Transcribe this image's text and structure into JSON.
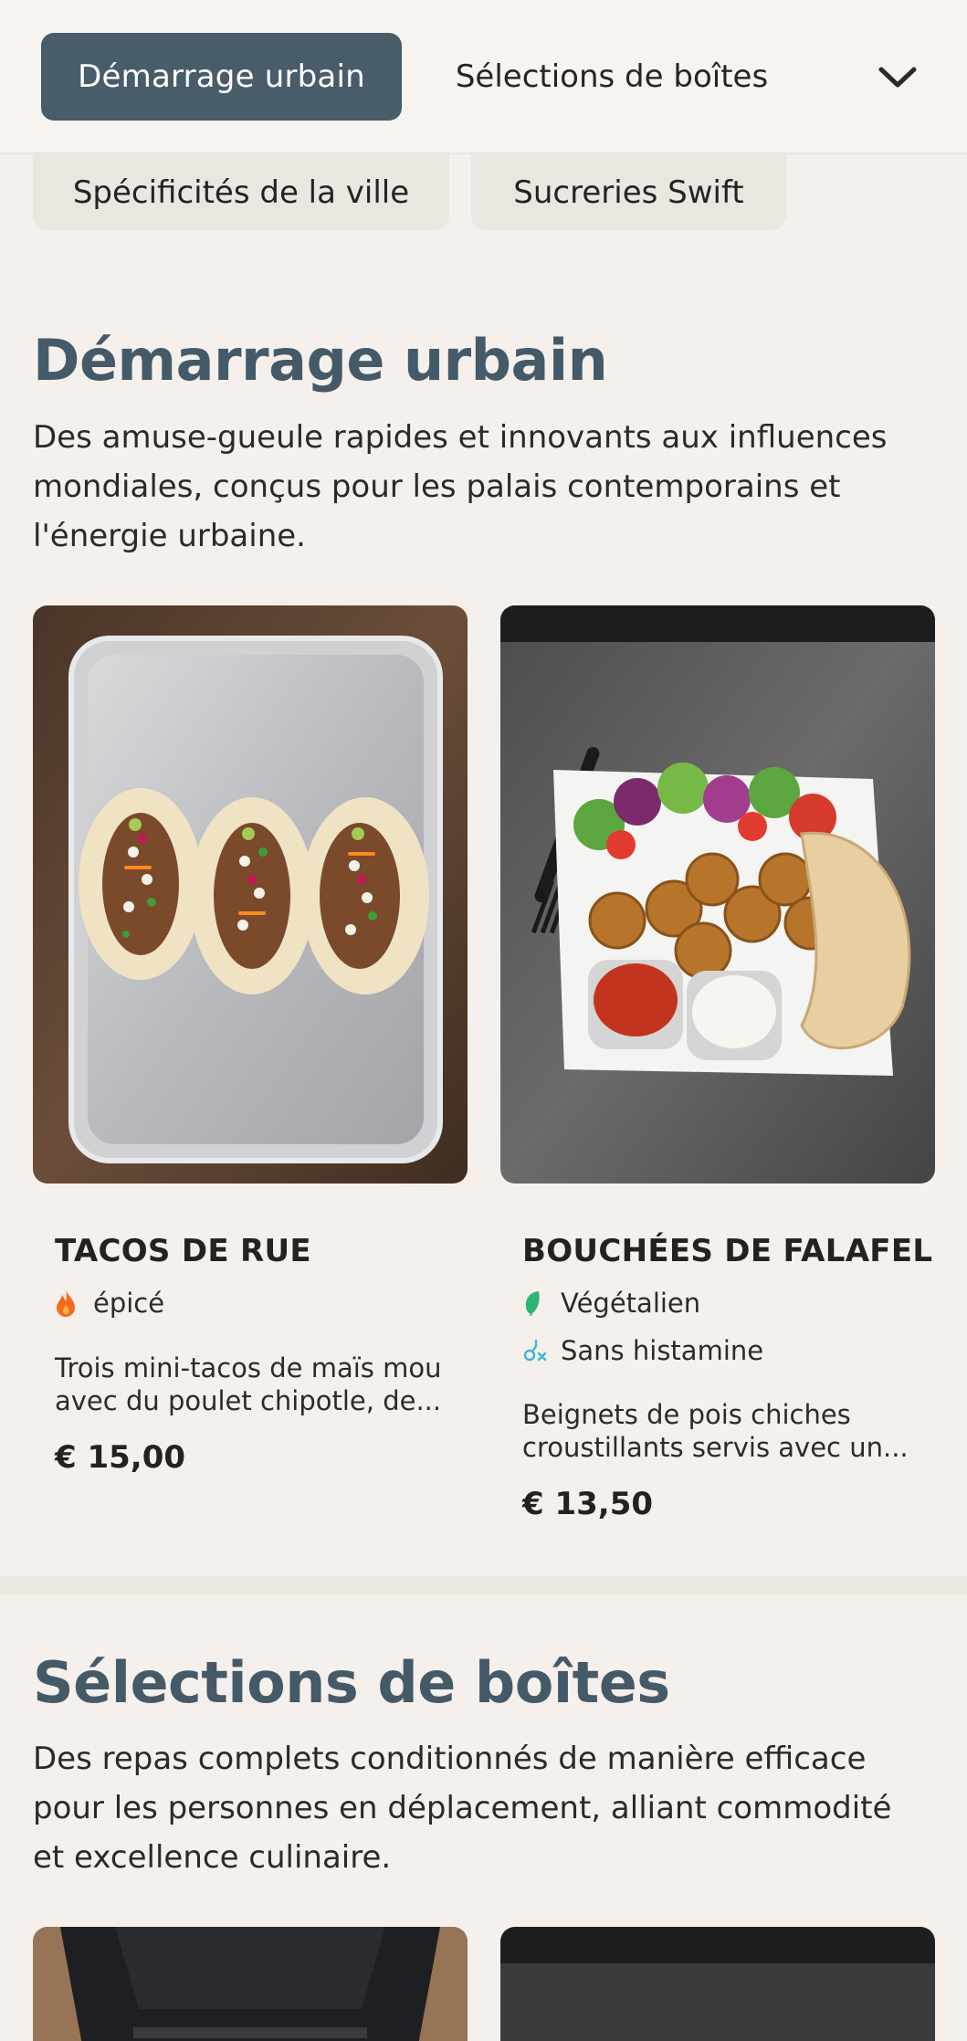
{
  "nav": {
    "active_tab": "Démarrage urbain",
    "next_tab": "Sélections de boîtes",
    "more_icon": "chevron-down-icon"
  },
  "chips": [
    "Spécificités de la ville",
    "Sucreries Swift"
  ],
  "sections": [
    {
      "title": "Démarrage urbain",
      "description": "Des amuse-gueule rapides et innovants aux influences mondiales, conçus pour les palais contemporains et l'énergie urbaine.",
      "items": [
        {
          "name": "TACOS DE RUE",
          "tags": [
            {
              "label": "épicé",
              "icon": "flame-icon",
              "color": "#f26b1d"
            }
          ],
          "description": "Trois mini-tacos de maïs mou avec du poulet chipotle, de...",
          "price": "€ 15,00"
        },
        {
          "name": "BOUCHÉES DE FALAFEL",
          "tags": [
            {
              "label": "Végétalien",
              "icon": "leaf-icon",
              "color": "#2bb673"
            },
            {
              "label": "Sans histamine",
              "icon": "histamine-free-icon",
              "color": "#3bb7d4"
            }
          ],
          "description": "Beignets de pois chiches croustillants servis avec un...",
          "price": "€ 13,50"
        }
      ]
    },
    {
      "title": "Sélections de boîtes",
      "description": "Des repas complets conditionnés de manière efficace pour les personnes en déplacement, alliant commodité et excellence culinaire."
    }
  ],
  "colors": {
    "background": "#f5f0eb",
    "accent": "#485c69",
    "title": "#455a68"
  }
}
